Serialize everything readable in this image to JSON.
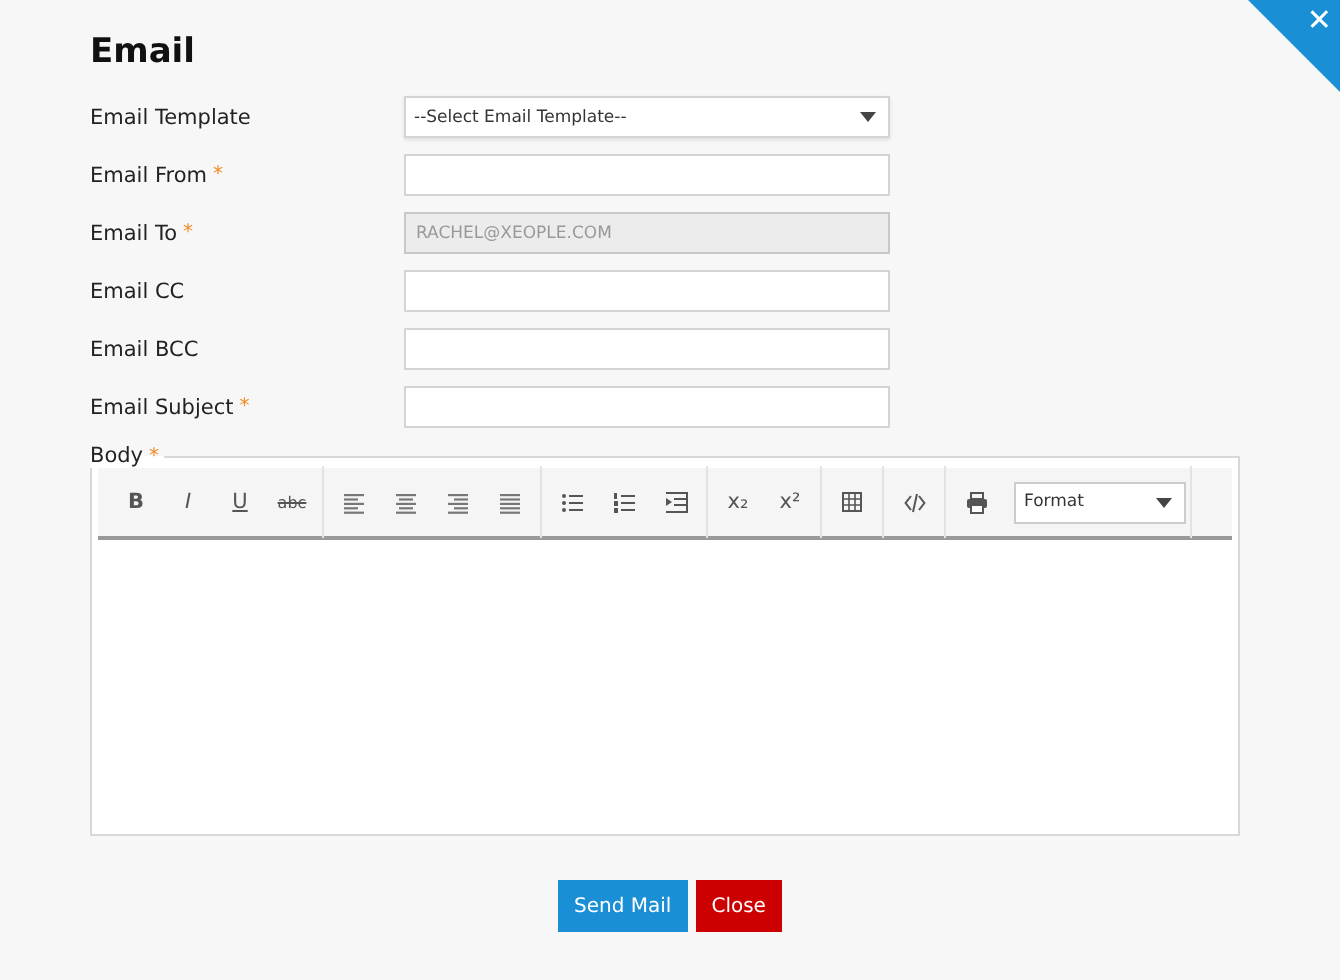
{
  "dialog": {
    "title": "Email",
    "close_icon_label": "✕"
  },
  "fields": [
    {
      "label": "Email Template",
      "kind": "select",
      "value": "--Select Email Template--",
      "disabled": false
    },
    {
      "label": "Email From",
      "required_mark": "*",
      "kind": "input",
      "disabled": false
    },
    {
      "label": "Email To",
      "required_mark": "*",
      "kind": "input",
      "value": "RACHEL@XEOPLE.COM",
      "disabled": true
    },
    {
      "label": "Email CC",
      "kind": "input",
      "disabled": false
    },
    {
      "label": "Email BCC",
      "kind": "input",
      "disabled": false
    },
    {
      "label": "Email Subject",
      "required_mark": "*",
      "kind": "input",
      "disabled": false
    }
  ],
  "body": {
    "label": "Body",
    "required_mark": "*",
    "style_buttons": [
      "B",
      "I",
      "U",
      "abc"
    ],
    "script_buttons": [
      "x₂",
      "x²"
    ],
    "format_select": "Format"
  },
  "buttons": [
    {
      "label": "Send Mail",
      "kind": "primary"
    },
    {
      "label": "Close",
      "kind": "danger"
    }
  ]
}
